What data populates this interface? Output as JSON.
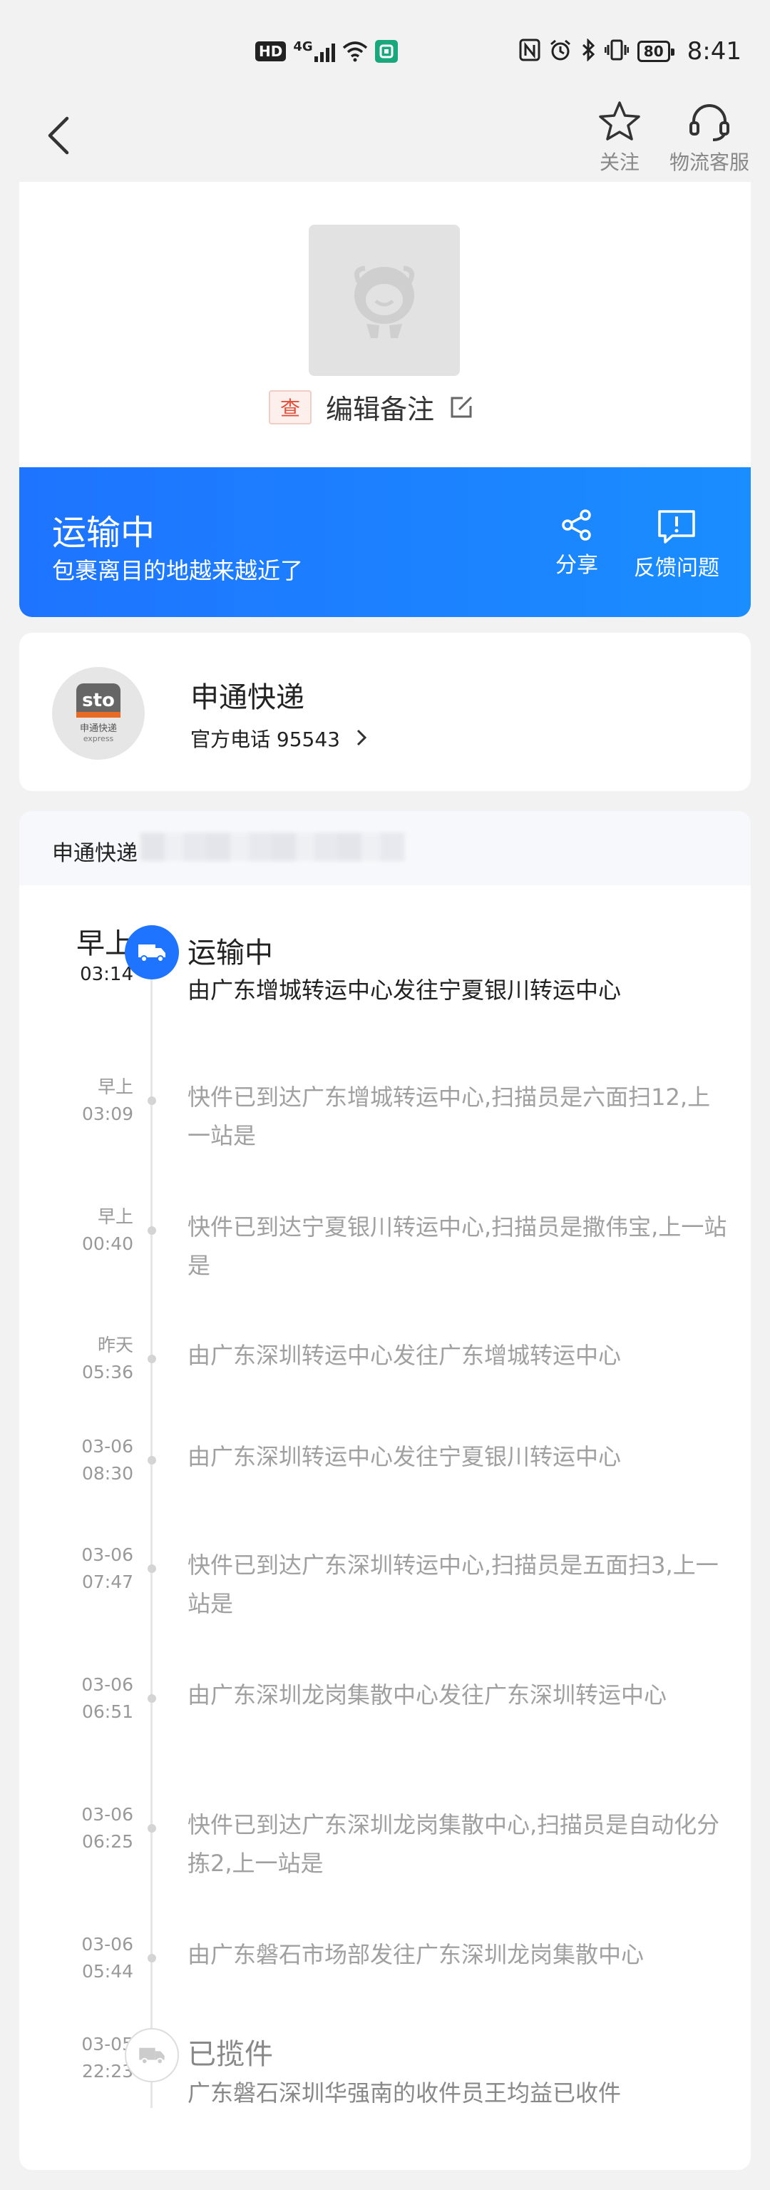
{
  "status_bar": {
    "hd": "HD",
    "network": "4G",
    "battery": "80",
    "time": "8:41"
  },
  "nav": {
    "follow_label": "关注",
    "service_label": "物流客服"
  },
  "package": {
    "query_badge": "查",
    "remark_label": "编辑备注"
  },
  "status_banner": {
    "title": "运输中",
    "subtitle": "包裹离目的地越来越近了",
    "share_label": "分享",
    "feedback_label": "反馈问题"
  },
  "carrier": {
    "logo_text": "sto",
    "logo_cn": "申通快递",
    "logo_en": "express",
    "name": "申通快递",
    "phone": "官方电话 95543"
  },
  "tracking": {
    "header_label": "申通快递",
    "events": [
      {
        "day": "早上",
        "time": "03:14",
        "title": "运输中",
        "text": "由广东增城转运中心发往宁夏银川转运中心"
      },
      {
        "day": "早上",
        "time": "03:09",
        "text": "快件已到达广东增城转运中心,扫描员是六面扫12,上一站是"
      },
      {
        "day": "早上",
        "time": "00:40",
        "text": "快件已到达宁夏银川转运中心,扫描员是撒伟宝,上一站是"
      },
      {
        "day": "昨天",
        "time": "05:36",
        "text": "由广东深圳转运中心发往广东增城转运中心"
      },
      {
        "day": "03-06",
        "time": "08:30",
        "text": "由广东深圳转运中心发往宁夏银川转运中心"
      },
      {
        "day": "03-06",
        "time": "07:47",
        "text": "快件已到达广东深圳转运中心,扫描员是五面扫3,上一站是"
      },
      {
        "day": "03-06",
        "time": "06:51",
        "text": "由广东深圳龙岗集散中心发往广东深圳转运中心"
      },
      {
        "day": "03-06",
        "time": "06:25",
        "text": "快件已到达广东深圳龙岗集散中心,扫描员是自动化分拣2,上一站是"
      },
      {
        "day": "03-06",
        "time": "05:44",
        "text": "由广东磐石市场部发往广东深圳龙岗集散中心"
      },
      {
        "day": "03-05",
        "time": "22:23",
        "title": "已揽件",
        "text": "广东磐石深圳华强南的收件员王均益已收件"
      }
    ]
  }
}
